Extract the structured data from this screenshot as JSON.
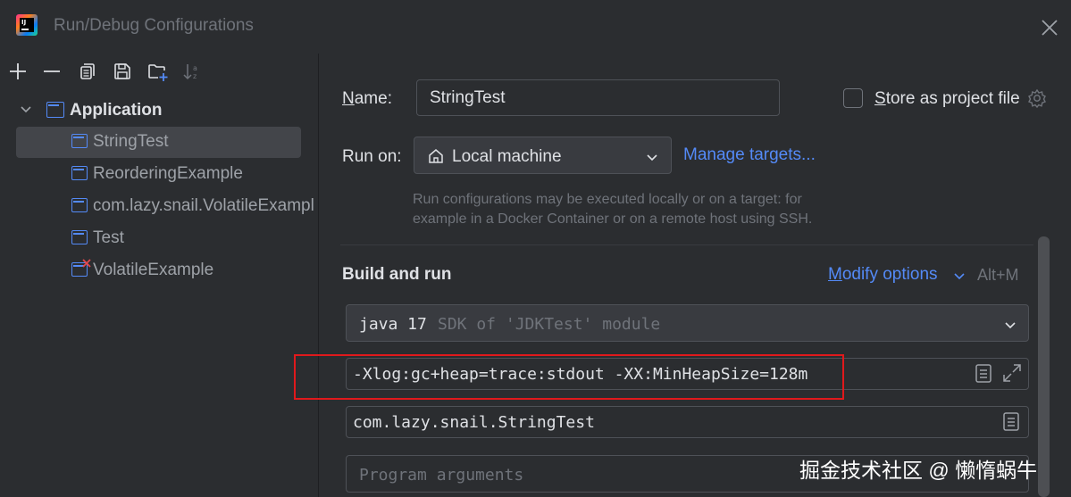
{
  "window": {
    "title": "Run/Debug Configurations"
  },
  "icons": {
    "add": "plus-icon",
    "remove": "minus-icon",
    "copy": "copy-icon",
    "save": "save-icon",
    "folder": "new-folder-icon",
    "sort": "sort-icon",
    "close": "close-icon",
    "settings": "gear-icon",
    "home": "home-icon",
    "chevron": "chevron-down-icon",
    "expand": "expand-icon",
    "document": "document-icon"
  },
  "tree": {
    "group": "Application",
    "items": [
      {
        "label": "StringTest",
        "selected": true,
        "error": false
      },
      {
        "label": "ReorderingExample",
        "selected": false,
        "error": false
      },
      {
        "label": "com.lazy.snail.VolatileExampl",
        "selected": false,
        "error": false
      },
      {
        "label": "Test",
        "selected": false,
        "error": false
      },
      {
        "label": "VolatileExample",
        "selected": false,
        "error": true
      }
    ]
  },
  "form": {
    "name_label_prefix": "N",
    "name_label_rest": "ame:",
    "name_value": "StringTest",
    "store_prefix": "S",
    "store_rest": "tore as project file",
    "store_checked": false,
    "run_on_label": "Run on:",
    "run_on_value": "Local machine",
    "manage_targets": "Manage targets...",
    "hint_line1": "Run configurations may be executed locally or on a target: for",
    "hint_line2": "example in a Docker Container or on a remote host using SSH."
  },
  "build": {
    "title": "Build and run",
    "modify_prefix": "M",
    "modify_rest": "odify options",
    "modify_shortcut": "Alt+M",
    "sdk_java": "java 17",
    "sdk_desc": "SDK of 'JDKTest' module",
    "vm_options": "-Xlog:gc+heap=trace:stdout -XX:MinHeapSize=128m",
    "main_class": "com.lazy.snail.StringTest",
    "program_args_placeholder": "Program arguments"
  },
  "watermark": "掘金技术社区 @ 懒惰蜗牛",
  "colors": {
    "background": "#2b2d30",
    "accent": "#548af7",
    "highlight_box": "#e0191c",
    "selected_row": "#43454a"
  }
}
